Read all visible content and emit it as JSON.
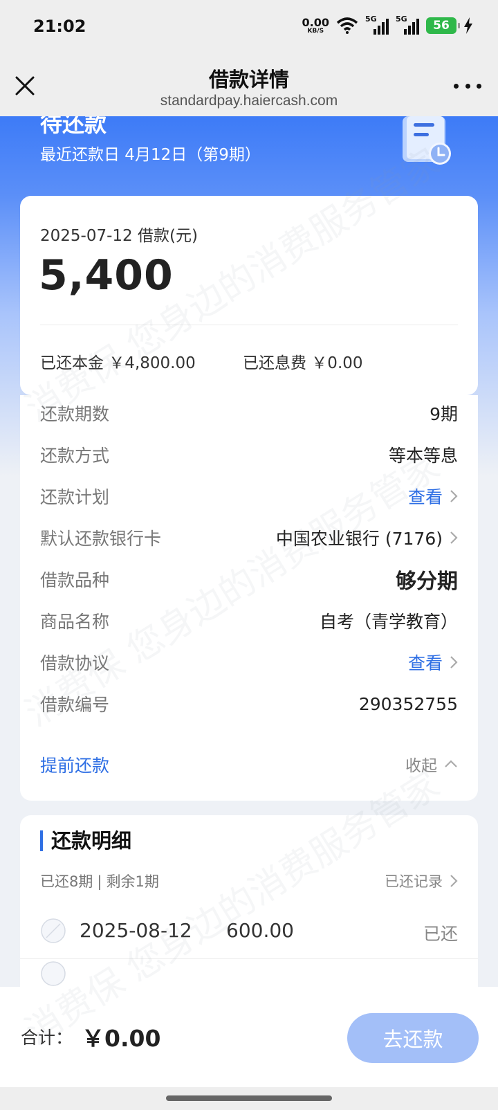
{
  "status_bar": {
    "time": "21:02",
    "net_speed_value": "0.00",
    "net_speed_unit": "KB/S",
    "signal1_label": "5G",
    "signal2_label": "5G",
    "battery": "56"
  },
  "nav": {
    "title": "借款详情",
    "url": "standardpay.haiercash.com"
  },
  "hero": {
    "status": "待还款",
    "subtitle": "最近还款日 4月12日（第9期）"
  },
  "summary": {
    "loan_date": "2025-07-12 借款(元)",
    "amount": "5,400",
    "paid_principal": "已还本金 ￥4,800.00",
    "paid_interest": "已还息费 ￥0.00"
  },
  "details": [
    {
      "label": "还款期数",
      "value": "9期"
    },
    {
      "label": "还款方式",
      "value": "等本等息"
    },
    {
      "label": "还款计划",
      "value": "查看"
    },
    {
      "label": "默认还款银行卡",
      "value": "中国农业银行 (7176)"
    },
    {
      "label": "借款品种",
      "value": "够分期"
    },
    {
      "label": "商品名称",
      "value": "自考（青学教育）"
    },
    {
      "label": "借款协议",
      "value": "查看"
    },
    {
      "label": "借款编号",
      "value": "290352755"
    }
  ],
  "actions": {
    "prepay": "提前还款",
    "collapse": "收起"
  },
  "repayment": {
    "title": "还款明细",
    "paid_periods": "已还8期",
    "separator": "|",
    "remaining": "剩余1期",
    "records_link": "已还记录",
    "rows": [
      {
        "date": "2025-08-12",
        "amount": "600.00",
        "status": "已还"
      }
    ]
  },
  "footer": {
    "total_label": "合计：",
    "total_value": "￥0.00",
    "pay_button": "去还款"
  },
  "watermark_text": "消费保 您身边的消费服务管家",
  "colors": {
    "accent": "#2f6fe4",
    "hero_top": "#3d7bf7",
    "pay_button_disabled": "#a3bff8",
    "battery": "#2fb84a"
  }
}
